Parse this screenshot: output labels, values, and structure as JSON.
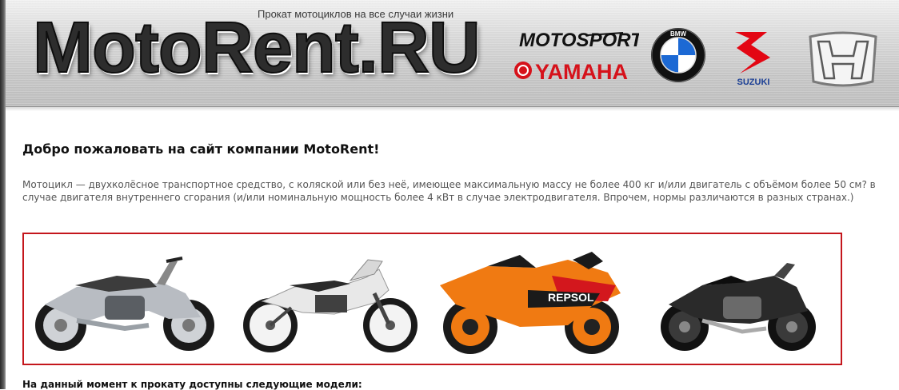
{
  "header": {
    "tagline": "Прокат мотоциклов на все случаи жизни",
    "logo_text": "MotoRent.RU",
    "brands": [
      {
        "name": "motosport-yamaha",
        "text_top": "MOTOSPORT",
        "text_bottom": "YAMAHA",
        "color": "#d6121b"
      },
      {
        "name": "bmw",
        "text": "BMW",
        "color": "#1c69d4"
      },
      {
        "name": "suzuki",
        "text": "SUZUKI",
        "color": "#e30613"
      },
      {
        "name": "honda",
        "text": "H",
        "color": "#8c8c8c"
      }
    ]
  },
  "main": {
    "title": "Добро пожаловать на сайт компании MotoRent!",
    "description": "Мотоцикл — двухколёсное транспортное средство, с коляской или без неё, имеющее максимальную массу не более 400 кг и/или двигатель с объёмом более 50 см? в случае двигателя внутреннего сгорания (и/или номинальную мощность более 4 кВт в случае электродвигателя. Впрочем, нормы различаются в разных странах.)",
    "models_heading": "На данный момент к прокату доступны следующие модели:"
  },
  "gallery": {
    "border_color": "#c4161c",
    "bikes": [
      {
        "name": "silver-cruiser",
        "color": "#b8bcc2"
      },
      {
        "name": "white-adventure",
        "color": "#e8e8e8"
      },
      {
        "name": "repsol-sportbike",
        "color": "#f07a12"
      },
      {
        "name": "black-muscle",
        "color": "#2a2a2a"
      }
    ]
  },
  "colors": {
    "accent": "#c4161c",
    "text": "#111111",
    "muted_text": "#555555"
  }
}
